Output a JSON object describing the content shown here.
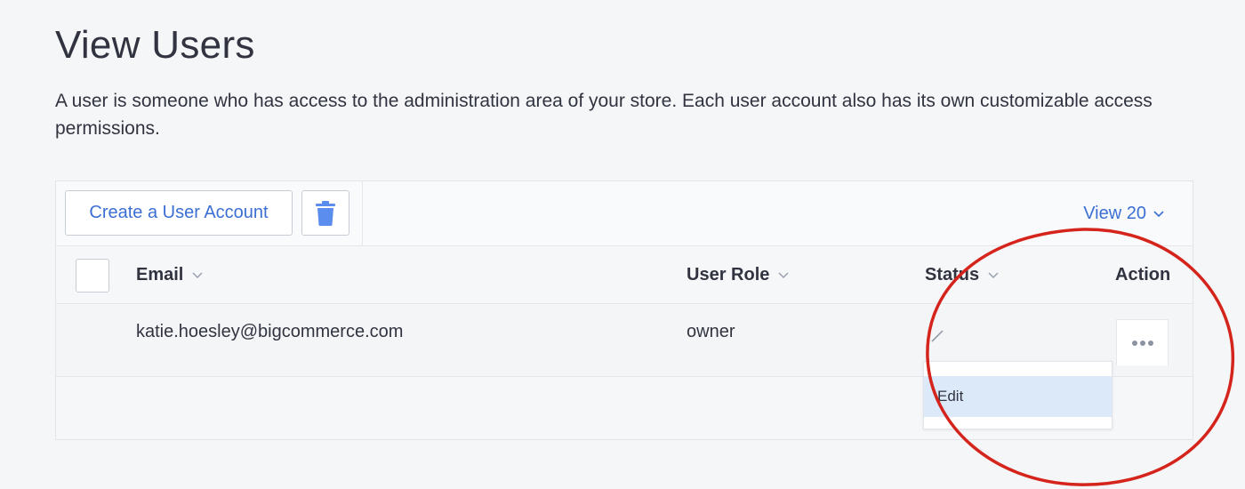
{
  "page": {
    "title": "View Users",
    "description": "A user is someone who has access to the administration area of your store. Each user account also has its own customizable access permissions."
  },
  "toolbar": {
    "create_label": "Create a User Account",
    "delete_icon": "trash-icon",
    "view_label": "View 20"
  },
  "table": {
    "columns": [
      "Email",
      "User Role",
      "Status",
      "Action"
    ],
    "rows": [
      {
        "email": "katie.hoesley@bigcommerce.com",
        "role": "owner"
      }
    ]
  },
  "action_menu": {
    "items": [
      "Edit"
    ]
  },
  "colors": {
    "accent": "#3b6fd4",
    "trash": "#5b8def",
    "highlight": "#dbe9f8",
    "annotation_circle": "#d4241b"
  }
}
